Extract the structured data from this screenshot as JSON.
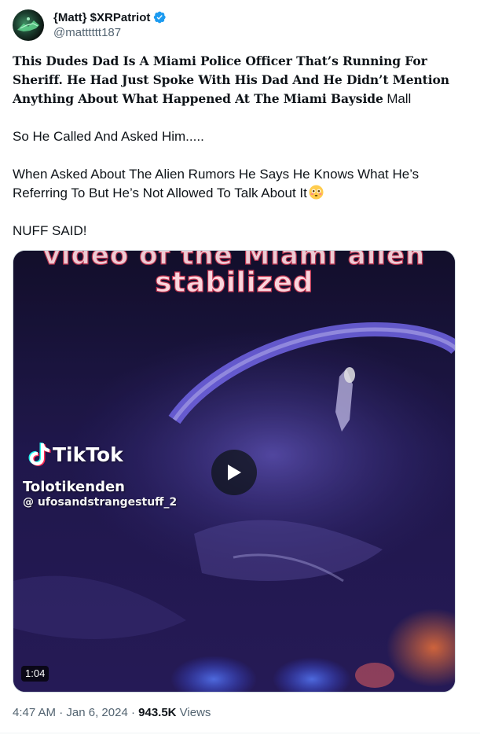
{
  "author": {
    "display_name": "{Matt} $XRPatriot",
    "handle": "@matttttt187",
    "verified_icon": "verified-badge-icon",
    "verified_color": "#1d9bf0"
  },
  "tweet": {
    "headline": "This Dudes Dad Is A Miami Police Officer That’s Running For Sheriff. He Had Just Spoke With His Dad And He Didn’t Mention Anything About What Happened At The Miami Bayside",
    "headline_tail": " Mall",
    "paragraph_2": "So He Called And Asked Him.....",
    "paragraph_3": "When Asked About The Alien Rumors He Says He Knows What He’s Referring To But He’s Not Allowed To Talk About It",
    "paragraph_3_emoji": "flushed-face-emoji",
    "paragraph_4": "NUFF SAID!"
  },
  "video": {
    "caption_top": "video of the Miami alien",
    "caption_main": "stabilized",
    "tiktok_wordmark": "TikTok",
    "tiktok_username": "Tolotikenden",
    "tiktok_handle": "@ ufosandstrangestuff_2",
    "duration": "1:04",
    "play_icon": "play-icon"
  },
  "meta": {
    "time": "4:47 AM",
    "separator_1": " · ",
    "date": "Jan 6, 2024",
    "separator_2": " · ",
    "views_count": "943.5K",
    "views_label": " Views"
  },
  "colors": {
    "text_primary": "#0f1419",
    "text_secondary": "#536471",
    "caption_fill": "#f9d6dd",
    "caption_stroke": "#c0334f"
  }
}
